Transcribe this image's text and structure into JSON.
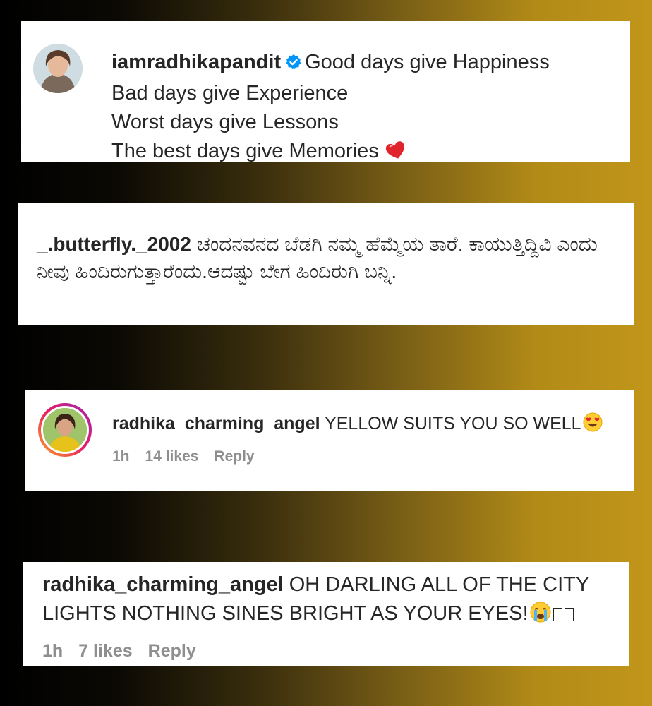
{
  "comments": [
    {
      "username": "iamradhikapandit",
      "verified": true,
      "lines": [
        "Good days give Happiness",
        "Bad days give Experience",
        "Worst days give Lessons",
        "The best days give Memories"
      ],
      "end_emoji": "heart-icon"
    },
    {
      "username": "_.butterfly._2002",
      "text": "ಚಂದನವನದ ಬೆಡಗಿ ನಮ್ಮ ಹೆಮ್ಮೆಯ ತಾರೆ. ಕಾಯುತ್ತಿದ್ದಿವಿ ಎಂದು ನೀವು ಹಿಂದಿರುಗುತ್ತಾರೆಂದು.ಆದಷ್ಟು ಬೇಗ ಹಿಂದಿರುಗಿ ಬನ್ನಿ."
    },
    {
      "username": "radhika_charming_angel",
      "text": "YELLOW SUITS YOU SO WELL",
      "end_emoji": "heart-eyes-emoji",
      "time": "1h",
      "likes": "14 likes",
      "reply": "Reply"
    },
    {
      "username": "radhika_charming_angel",
      "text": "OH DARLING ALL OF THE CITY LIGHTS NOTHING SINES BRIGHT AS YOUR EYES!",
      "end_emoji": "crying-face-emoji",
      "time": "1h",
      "likes": "7 likes",
      "reply": "Reply"
    }
  ],
  "colors": {
    "verified": "#0095f6",
    "meta": "#8e8e8e",
    "text": "#262626",
    "heart": "#e0242b"
  }
}
